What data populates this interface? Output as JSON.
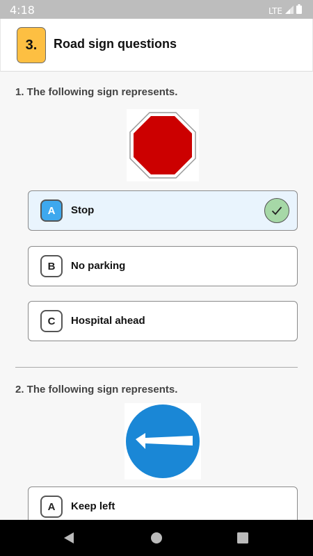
{
  "status_bar": {
    "time": "4:18",
    "network": "LTE"
  },
  "header": {
    "number": "3.",
    "title": "Road sign questions"
  },
  "questions": [
    {
      "title": "1. The following sign represents.",
      "options": [
        {
          "letter": "A",
          "label": "Stop",
          "selected": true
        },
        {
          "letter": "B",
          "label": "No parking",
          "selected": false
        },
        {
          "letter": "C",
          "label": "Hospital ahead",
          "selected": false
        }
      ]
    },
    {
      "title": "2. The following sign represents.",
      "options": [
        {
          "letter": "A",
          "label": "Keep left",
          "selected": false
        }
      ]
    }
  ],
  "colors": {
    "badge": "#fdbf42",
    "selected_letter": "#3ea8ee",
    "check": "#a6d8a7",
    "stop_sign": "#cc0000",
    "keep_left_sign": "#1a87d6"
  }
}
